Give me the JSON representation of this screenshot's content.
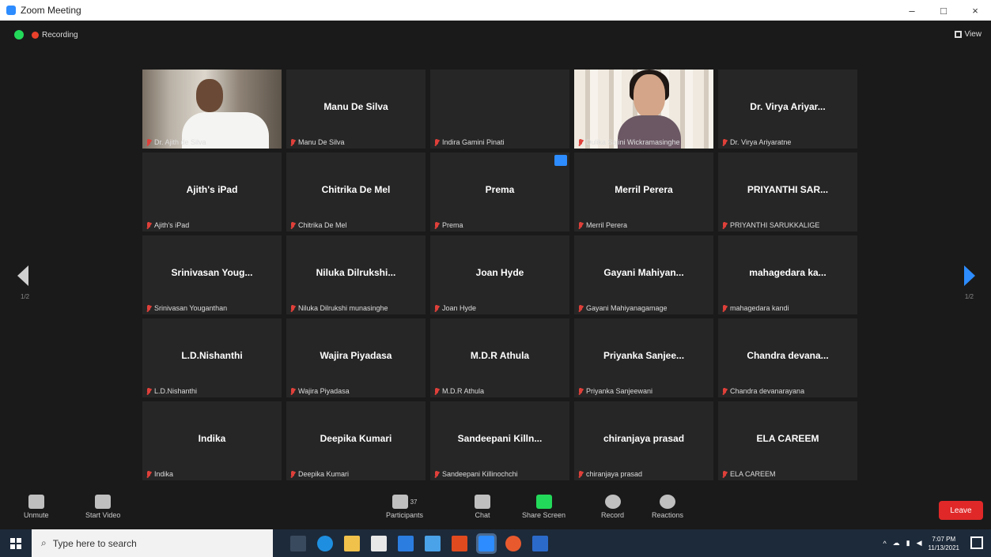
{
  "window": {
    "title": "Zoom Meeting",
    "controls": [
      "–",
      "□",
      "×"
    ]
  },
  "meeting": {
    "recording_label": "Recording",
    "view_label": "View",
    "page_prev": "1/2",
    "page_next": "1/2",
    "tiles": [
      {
        "name": "",
        "label": "Dr. Ajith de Silva",
        "video": "man"
      },
      {
        "name": "Manu De Silva",
        "label": "Manu De Silva"
      },
      {
        "name": "",
        "label": "Indira Gamini Pinati"
      },
      {
        "name": "",
        "label": "Dulika Sajini Wickramasinghe",
        "video": "woman"
      },
      {
        "name": "Dr. Virya Ariyar...",
        "label": "Dr. Virya Ariyaratne"
      },
      {
        "name": "Ajith's iPad",
        "label": "Ajith's iPad"
      },
      {
        "name": "Chitrika De Mel",
        "label": "Chitrika De Mel"
      },
      {
        "name": "Prema",
        "label": "Prema",
        "badge": true
      },
      {
        "name": "Merril Perera",
        "label": "Merril Perera"
      },
      {
        "name": "PRIYANTHI SAR...",
        "label": "PRIYANTHI SARUKKALIGE"
      },
      {
        "name": "Srinivasan Youg...",
        "label": "Srinivasan Youganthan"
      },
      {
        "name": "Niluka Dilrukshi...",
        "label": "Niluka Dilrukshi munasinghe"
      },
      {
        "name": "Joan Hyde",
        "label": "Joan Hyde"
      },
      {
        "name": "Gayani Mahiyan...",
        "label": "Gayani Mahiyanagamage"
      },
      {
        "name": "mahagedara ka...",
        "label": "mahagedara kandi"
      },
      {
        "name": "L.D.Nishanthi",
        "label": "L.D.Nishanthi"
      },
      {
        "name": "Wajira Piyadasa",
        "label": "Wajira Piyadasa"
      },
      {
        "name": "M.D.R Athula",
        "label": "M.D.R Athula"
      },
      {
        "name": "Priyanka Sanjee...",
        "label": "Priyanka Sanjeewani"
      },
      {
        "name": "Chandra devana...",
        "label": "Chandra devanarayana"
      },
      {
        "name": "Indika",
        "label": "Indika"
      },
      {
        "name": "Deepika Kumari",
        "label": "Deepika Kumari"
      },
      {
        "name": "Sandeepani Killn...",
        "label": "Sandeepani Killinochchi"
      },
      {
        "name": "chiranjaya prasad",
        "label": "chiranjaya prasad"
      },
      {
        "name": "ELA CAREEM",
        "label": "ELA CAREEM"
      }
    ]
  },
  "toolbar": {
    "unmute": "Unmute",
    "start_video": "Start Video",
    "participants": "Participants",
    "participants_count": "37",
    "chat": "Chat",
    "share_screen": "Share Screen",
    "record": "Record",
    "reactions": "Reactions",
    "leave": "Leave"
  },
  "taskbar": {
    "search_placeholder": "Type here to search",
    "time": "7:07 PM",
    "date": "11/13/2021"
  },
  "colors": {
    "accent": "#2d8cff",
    "active_speaker": "#b9d430",
    "leave": "#e02828",
    "share": "#23d959"
  }
}
